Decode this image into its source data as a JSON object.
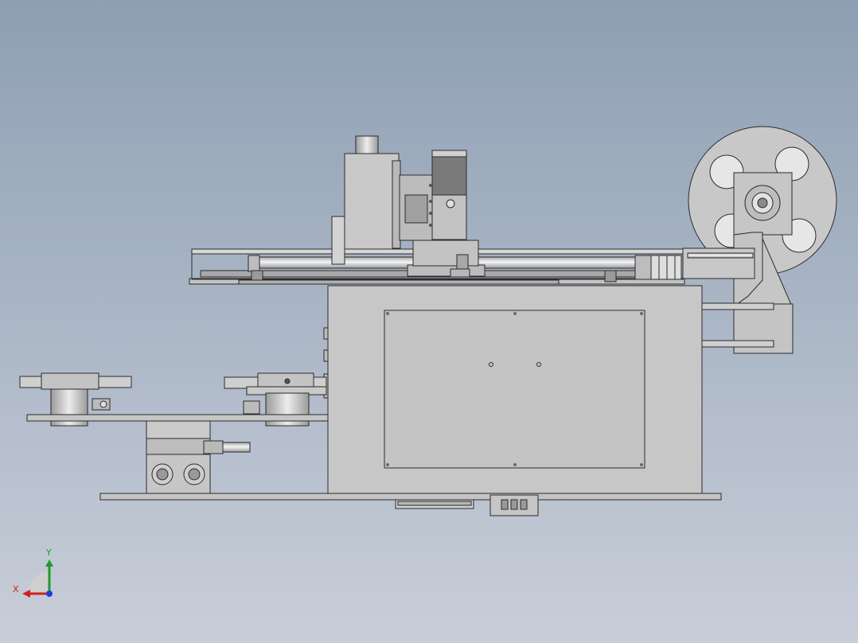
{
  "viewport": {
    "background_top": "#8e9fb3",
    "background_bottom": "#c8ced9"
  },
  "colors": {
    "part_fill": "#c9c9c9",
    "part_light": "#dcdcdc",
    "part_dark": "#9a9a9a",
    "part_darker": "#6f6f6f",
    "edge": "#2b2b2b",
    "rod_highlight": "#f2f2f2"
  },
  "triad": {
    "x_label": "X",
    "y_label": "Y",
    "x_color": "#d11f1f",
    "y_color": "#1f9a2a",
    "z_color": "#1f3fd1"
  },
  "icons": [
    "coordinate-triad-icon"
  ]
}
